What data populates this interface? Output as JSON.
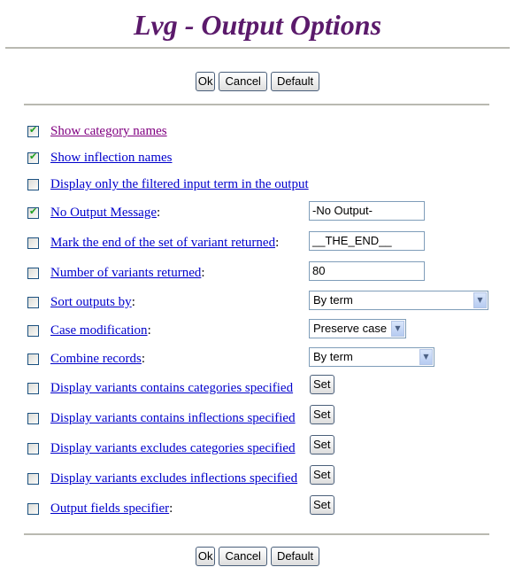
{
  "page": {
    "title": "Lvg - Output Options"
  },
  "buttons": {
    "ok": "Ok",
    "cancel": "Cancel",
    "default": "Default",
    "set": "Set"
  },
  "options": [
    {
      "label": "Show category names",
      "suffix": "",
      "checked": true,
      "visited": true
    },
    {
      "label": "Show inflection names",
      "suffix": "",
      "checked": true
    },
    {
      "label": "Display only the filtered input term in the output",
      "suffix": "",
      "checked": false
    },
    {
      "label": "No Output Message",
      "suffix": ":",
      "checked": true,
      "control": "text",
      "value": "-No Output-"
    },
    {
      "label": "Mark the end of the set of variant returned",
      "suffix": ":",
      "checked": false,
      "control": "text",
      "value": "__THE_END__"
    },
    {
      "label": "Number of variants returned",
      "suffix": ":",
      "checked": false,
      "control": "text",
      "value": "80"
    },
    {
      "label": "Sort outputs by",
      "suffix": ":",
      "checked": false,
      "control": "select",
      "value": "By term"
    },
    {
      "label": "Case modification",
      "suffix": ":",
      "checked": false,
      "control": "select",
      "value": "Preserve case"
    },
    {
      "label": "Combine records",
      "suffix": ":",
      "checked": false,
      "control": "select",
      "value": "By term"
    },
    {
      "label": "Display variants contains categories specified",
      "suffix": "",
      "checked": false,
      "control": "button"
    },
    {
      "label": "Display variants contains inflections specified",
      "suffix": "",
      "checked": false,
      "control": "button"
    },
    {
      "label": "Display variants excludes categories specified",
      "suffix": "",
      "checked": false,
      "control": "button"
    },
    {
      "label": "Display variants excludes inflections specified",
      "suffix": "",
      "checked": false,
      "control": "button"
    },
    {
      "label": "Output fields specifier",
      "suffix": ":",
      "checked": false,
      "control": "button"
    }
  ],
  "icons": {
    "check": "✔",
    "dropdown": "▼"
  },
  "colors": {
    "title": "#5b1a6b",
    "link": "#0000cc",
    "visited_link": "#800080",
    "check": "#21a121"
  }
}
